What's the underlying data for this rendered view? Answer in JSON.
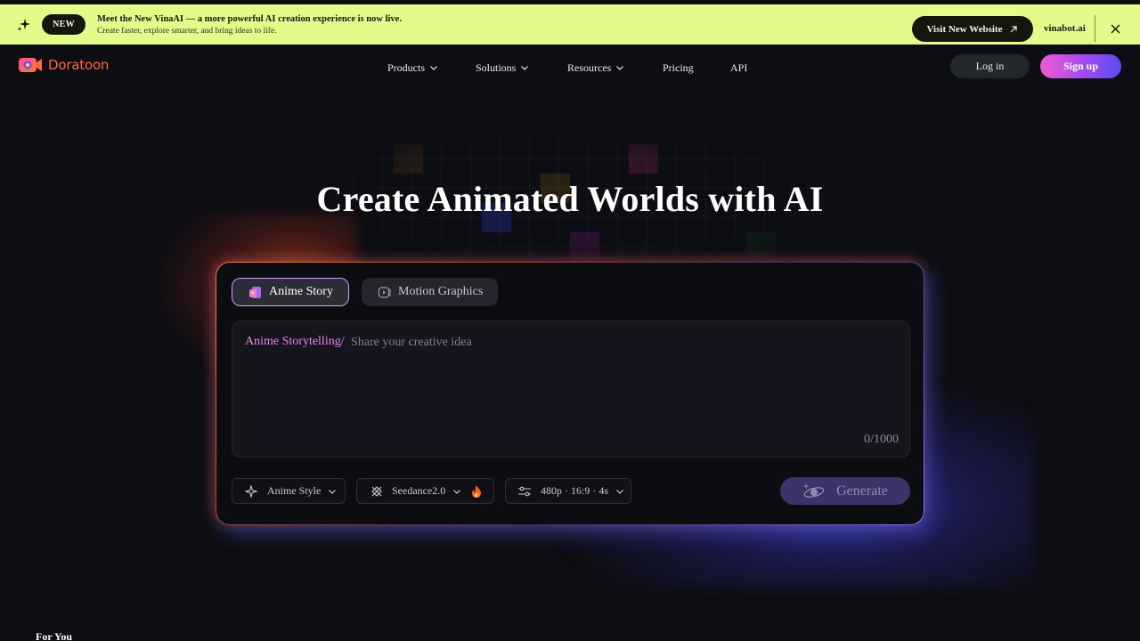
{
  "banner": {
    "badge": "NEW",
    "headline": "Meet the New VinaAI — a more powerful AI creation experience is now live.",
    "subtext": "Create faster, explore smarter, and bring ideas to life.",
    "visit_button": "Visit New Website",
    "site_link": "vinabot.ai",
    "background_color": "#e4fb8a"
  },
  "brand": {
    "name": "Doratoon",
    "color": "#ff6a3d"
  },
  "nav": {
    "items": [
      {
        "label": "Products",
        "has_dropdown": true
      },
      {
        "label": "Solutions",
        "has_dropdown": true
      },
      {
        "label": "Resources",
        "has_dropdown": true
      },
      {
        "label": "Pricing",
        "has_dropdown": false
      },
      {
        "label": "API",
        "has_dropdown": false
      }
    ],
    "login": "Log in",
    "signup": "Sign up"
  },
  "hero": {
    "title": "Create Animated Worlds with AI"
  },
  "panel": {
    "tabs": [
      {
        "label": "Anime Story",
        "active": true,
        "icon": "anime-story-icon"
      },
      {
        "label": "Motion Graphics",
        "active": false,
        "icon": "motion-graphics-icon"
      }
    ],
    "prompt": {
      "prefix": "Anime Storytelling/",
      "placeholder": "Share your creative idea",
      "value": "",
      "char_count": "0/1000"
    },
    "options": {
      "style": "Anime Style",
      "model": "Seedance2.0",
      "settings": "480p · 16:9 · 4s"
    },
    "generate": "Generate"
  },
  "section": {
    "for_you": "For You"
  },
  "colors": {
    "accent_pink": "#ef86e6",
    "accent_purple": "#5a4bf0",
    "page_bg": "#0d0e13"
  }
}
